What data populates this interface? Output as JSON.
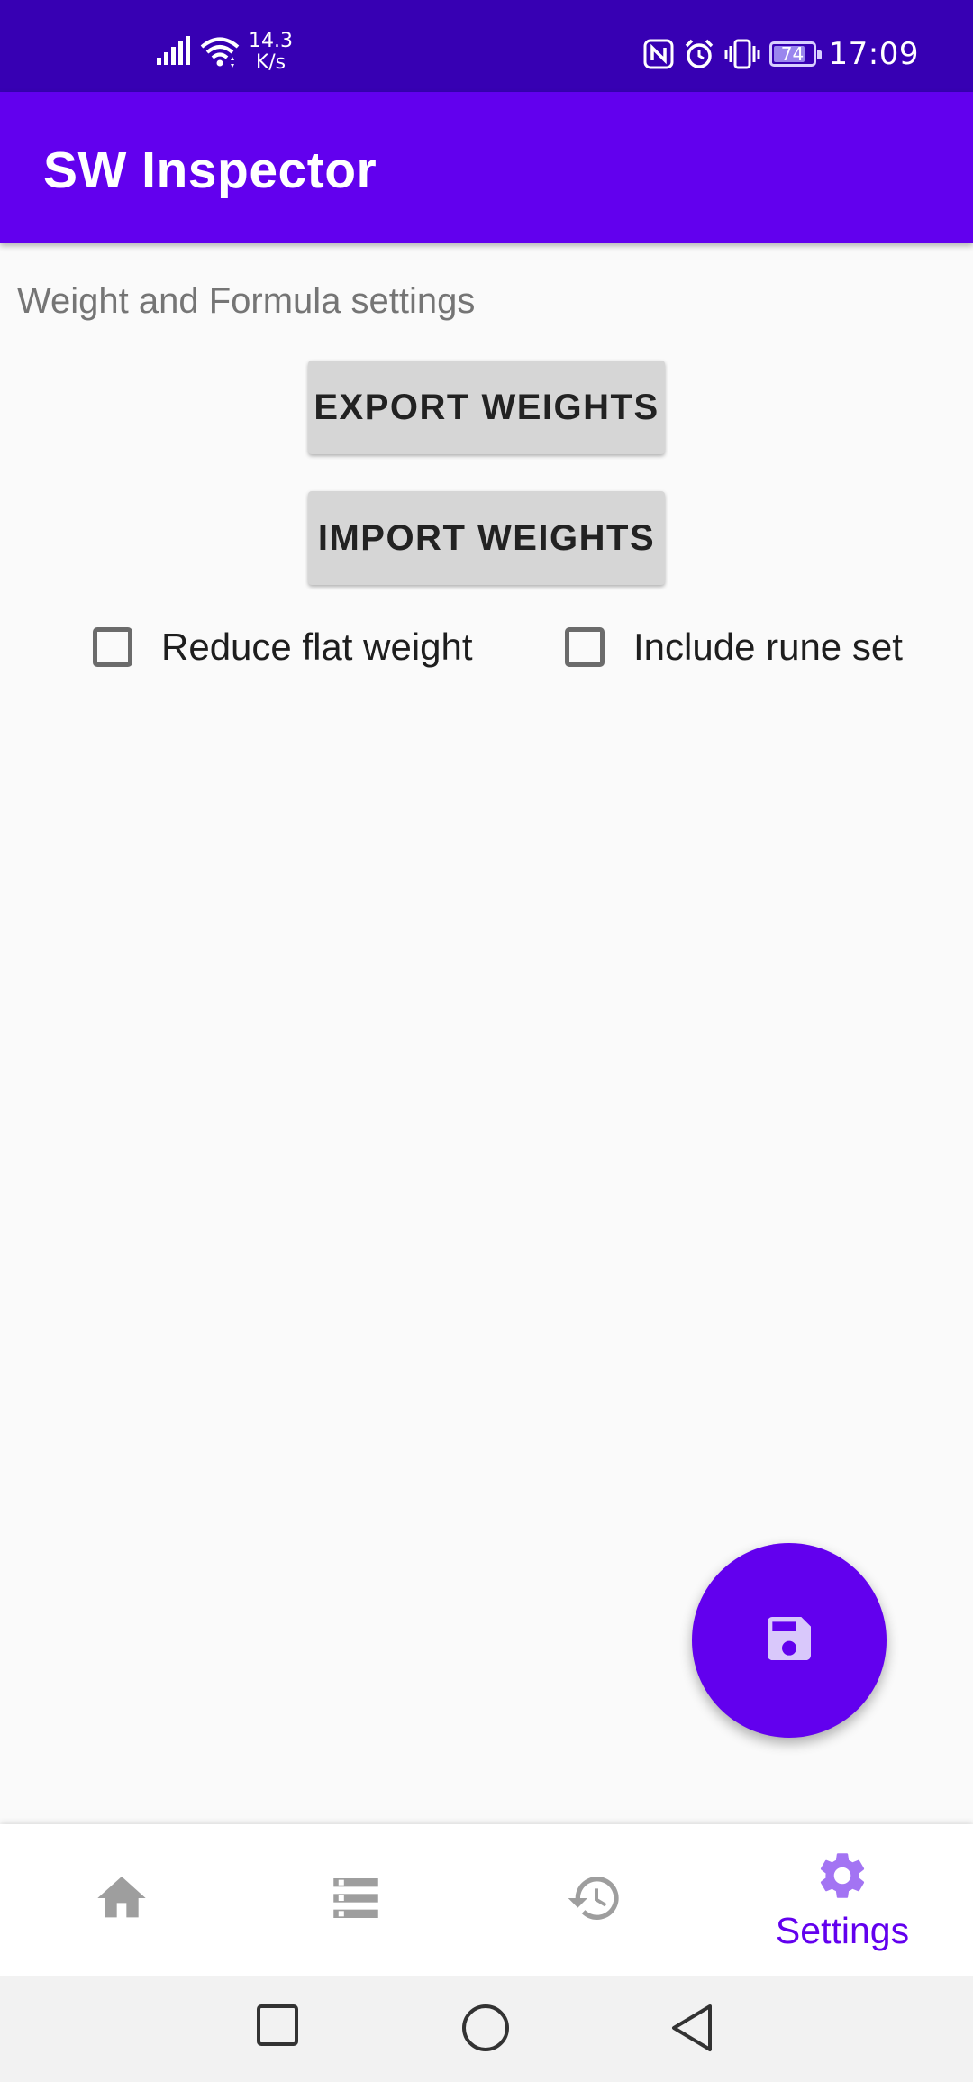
{
  "status_bar": {
    "net_speed_value": "14.3",
    "net_speed_unit": "K/s",
    "battery": "74",
    "battery_level": 0.74,
    "time": "17:09",
    "icons": [
      "signal-icon",
      "wifi-icon",
      "nfc-icon",
      "alarm-icon",
      "vibrate-icon",
      "battery-icon"
    ]
  },
  "app_bar": {
    "title": "SW Inspector"
  },
  "main": {
    "section_label": "Weight and Formula settings",
    "export_button": "EXPORT WEIGHTS",
    "import_button": "IMPORT WEIGHTS",
    "checkboxes": [
      {
        "label": "Reduce flat weight",
        "checked": false
      },
      {
        "label": "Include rune set",
        "checked": false
      }
    ]
  },
  "fab": {
    "icon": "save-icon"
  },
  "bottom_nav": {
    "items": [
      {
        "icon": "home-icon",
        "label": "",
        "active": false
      },
      {
        "icon": "list-icon",
        "label": "",
        "active": false
      },
      {
        "icon": "history-icon",
        "label": "",
        "active": false
      },
      {
        "icon": "gear-icon",
        "label": "Settings",
        "active": true
      }
    ]
  },
  "system_nav": {
    "icons": [
      "recents-square-icon",
      "home-circle-icon",
      "back-triangle-icon"
    ]
  },
  "colors": {
    "status_bar": "#3700b3",
    "primary": "#6200ee",
    "inactive_icon": "#9e9e9e",
    "active_icon": "#a374f3",
    "background": "#fafafa"
  }
}
